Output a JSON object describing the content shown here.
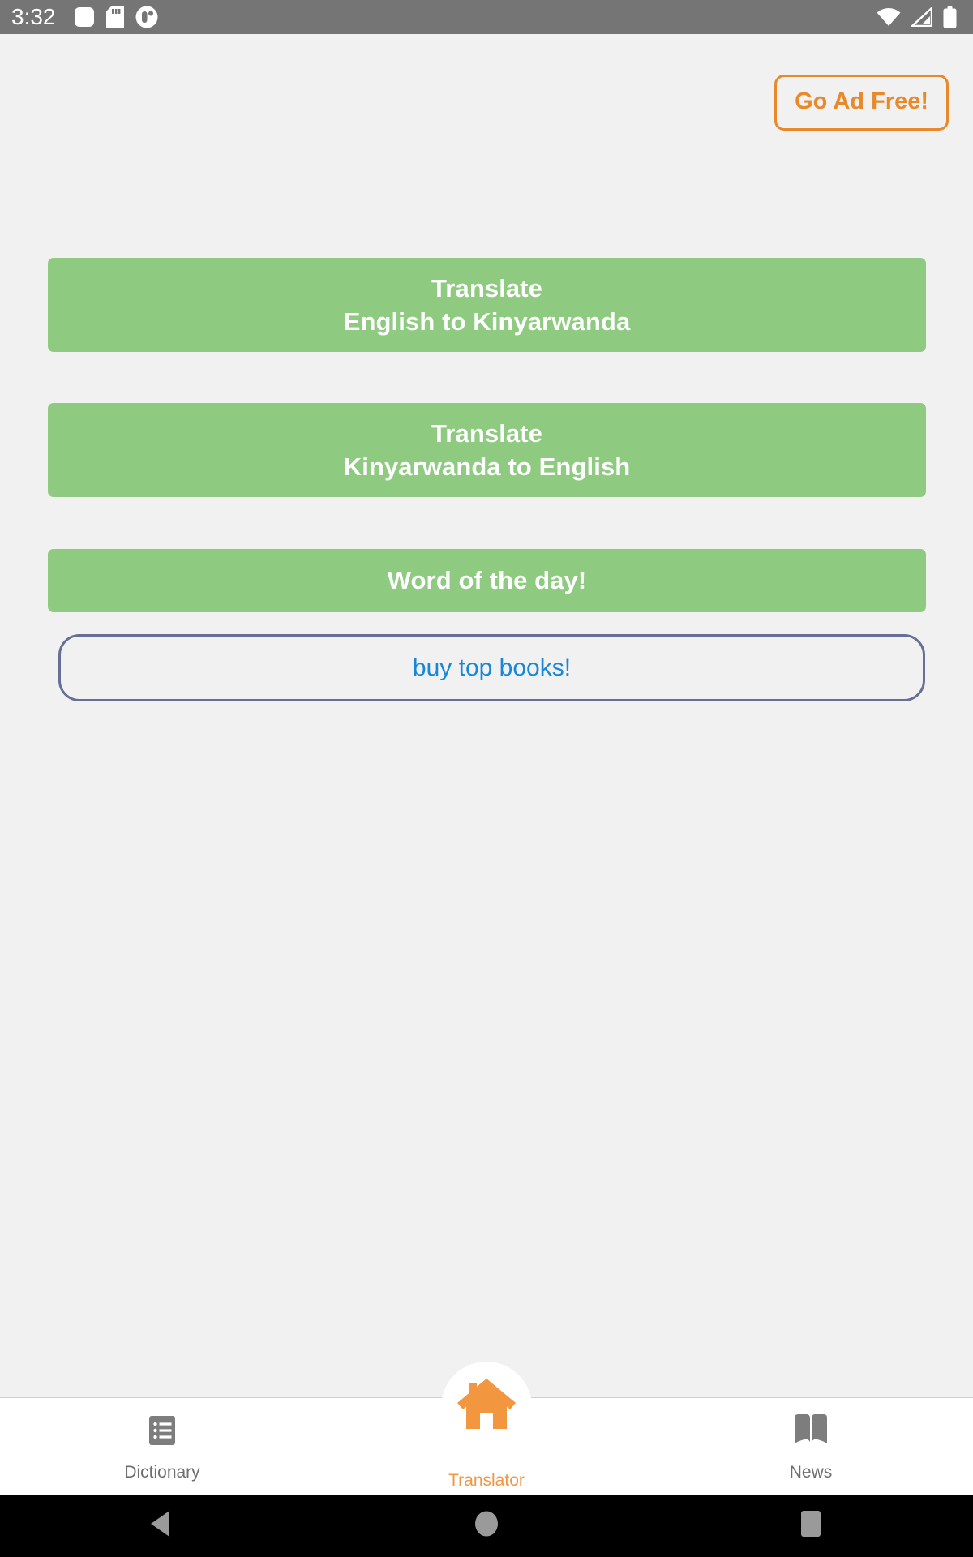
{
  "status_bar": {
    "time": "3:32",
    "left_icons": [
      "app-notification-icon",
      "sd-card-icon",
      "app-circle-icon"
    ],
    "right_icons": [
      "wifi-icon",
      "cellular-signal-icon",
      "battery-icon"
    ],
    "background_color": "#757575",
    "foreground_color": "#ffffff"
  },
  "header": {
    "go_ad_free_label": "Go Ad Free!",
    "accent_color": "#E8892B"
  },
  "main": {
    "background_color": "#f1f1f1",
    "green_color": "#8ECB80",
    "buttons": [
      {
        "name": "translate-english-to-kinyarwanda",
        "line1": "Translate",
        "line2": "English to Kinyarwanda",
        "style": "green"
      },
      {
        "name": "translate-kinyarwanda-to-english",
        "line1": "Translate",
        "line2": "Kinyarwanda to English",
        "style": "green"
      },
      {
        "name": "word-of-the-day",
        "line1": "Word of the day!",
        "line2": "",
        "style": "green"
      }
    ],
    "buy_books": {
      "label": "buy top books!",
      "text_color": "#1787D8",
      "border_color": "#696E93"
    }
  },
  "bottom_nav": {
    "active_color": "#F29640",
    "inactive_color": "#6E6E6E",
    "items": [
      {
        "label": "Dictionary",
        "icon": "list-document-icon",
        "active": false
      },
      {
        "label": "Translator",
        "icon": "home-icon",
        "active": true
      },
      {
        "label": "News",
        "icon": "open-book-icon",
        "active": false
      }
    ]
  },
  "system_nav": {
    "background_color": "#000000",
    "buttons": [
      {
        "name": "back-button",
        "icon": "back-triangle-icon"
      },
      {
        "name": "home-button",
        "icon": "home-circle-icon"
      },
      {
        "name": "recents-button",
        "icon": "recents-square-icon"
      }
    ]
  }
}
